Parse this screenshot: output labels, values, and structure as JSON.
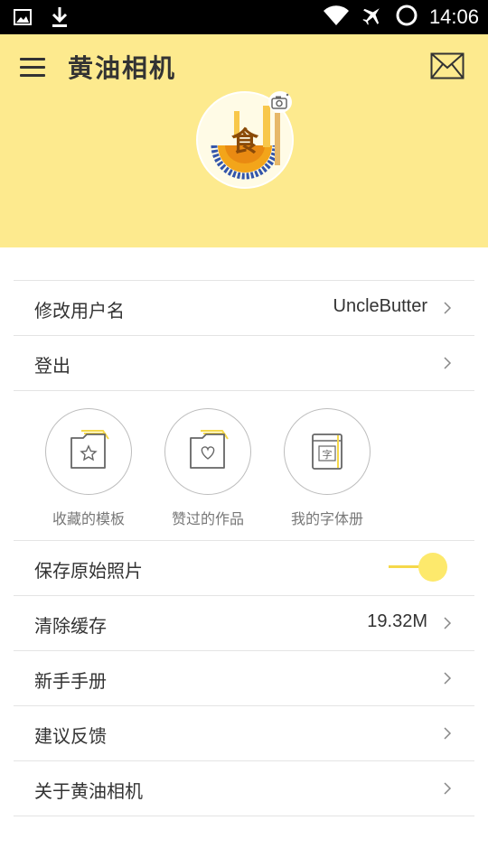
{
  "status_bar": {
    "time": "14:06",
    "icons": [
      "image-icon",
      "download-icon",
      "wifi-icon",
      "airplane-icon",
      "loading-ring-icon"
    ]
  },
  "header": {
    "title": "黄油相机",
    "menu_icon": "hamburger-menu-icon",
    "mail_icon": "mail-icon",
    "background_color": "#fdea8e"
  },
  "profile": {
    "avatar_icon": "avatar-image",
    "camera_icon": "camera-icon"
  },
  "account_rows": [
    {
      "label": "修改用户名",
      "value": "UncleButter"
    },
    {
      "label": "登出",
      "value": ""
    }
  ],
  "shortcuts": [
    {
      "label": "收藏的模板",
      "icon": "folder-star-icon"
    },
    {
      "label": "赞过的作品",
      "icon": "folder-heart-icon"
    },
    {
      "label": "我的字体册",
      "icon": "font-book-icon"
    }
  ],
  "settings_rows": [
    {
      "label": "保存原始照片",
      "toggle_on": true
    },
    {
      "label": "清除缓存",
      "value": "19.32M"
    },
    {
      "label": "新手手册",
      "value": ""
    },
    {
      "label": "建议反馈",
      "value": ""
    },
    {
      "label": "关于黄油相机",
      "value": ""
    }
  ],
  "accent_color": "#fde96c"
}
